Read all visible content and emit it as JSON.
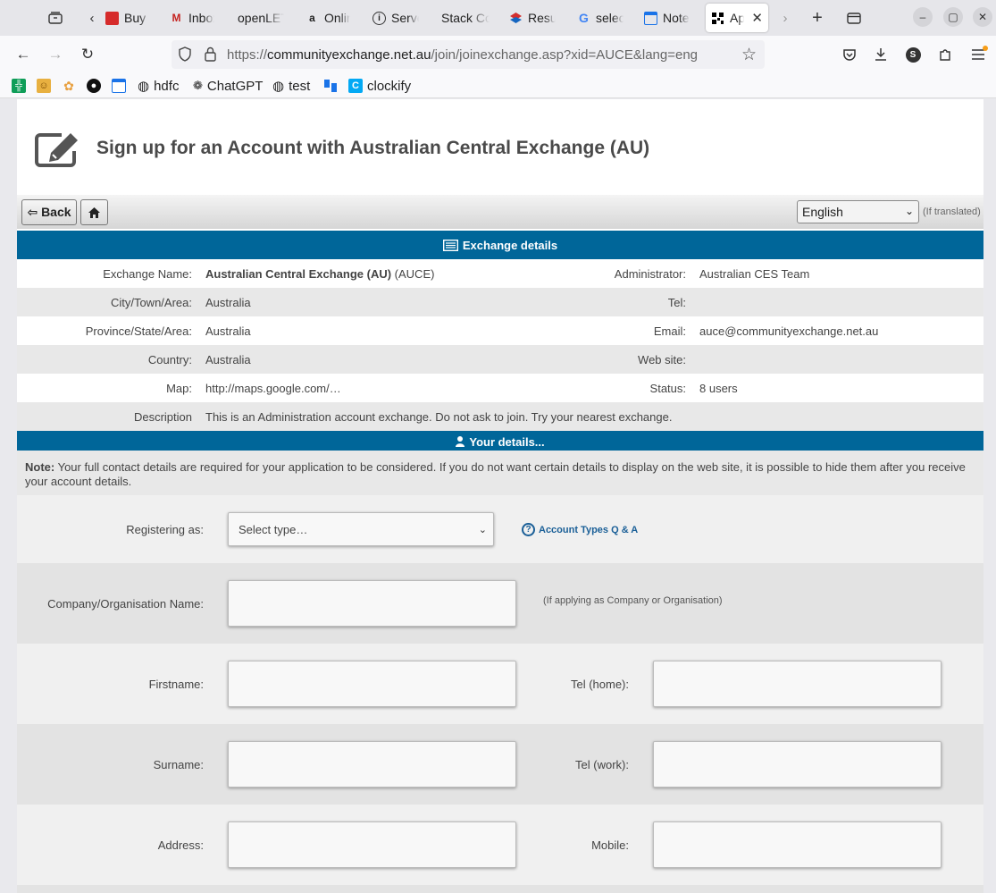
{
  "browser": {
    "tabs": [
      {
        "title": "Buy E",
        "favicon": "red-flag-icon",
        "color": "#d62b2b"
      },
      {
        "title": "Inbox",
        "favicon": "gmail-icon",
        "color": "#c5221f"
      },
      {
        "title": "openLET",
        "favicon": "",
        "color": ""
      },
      {
        "title": "Onlin",
        "favicon": "amazon-icon",
        "color": "#222222"
      },
      {
        "title": "Serve",
        "favicon": "info-icon",
        "color": "#333333"
      },
      {
        "title": "Stack Co",
        "favicon": "",
        "color": ""
      },
      {
        "title": "Resu",
        "favicon": "layers-icon",
        "color": "#d32f2f"
      },
      {
        "title": "selec",
        "favicon": "google-icon",
        "color": "#4285f4"
      },
      {
        "title": "Note",
        "favicon": "calendar-icon",
        "color": "#1a73e8"
      },
      {
        "title": "Ap",
        "favicon": "qr-icon",
        "color": "#000000",
        "active": true
      }
    ],
    "url_prefix": "https://",
    "url_domain": "communityexchange.net.au",
    "url_path": "/join/joinexchange.asp?xid=AUCE&lang=eng",
    "profile_letter": "S",
    "bookmarks": [
      {
        "label": "",
        "icon": "sheets-icon"
      },
      {
        "label": "",
        "icon": "face-icon"
      },
      {
        "label": "",
        "icon": "lotus-icon"
      },
      {
        "label": "",
        "icon": "github-icon"
      },
      {
        "label": "",
        "icon": "calendar-icon"
      },
      {
        "label": "hdfc",
        "icon": "globe-icon"
      },
      {
        "label": "ChatGPT",
        "icon": "chatgpt-icon"
      },
      {
        "label": "test",
        "icon": "globe-icon"
      },
      {
        "label": "",
        "icon": "trello-icon"
      },
      {
        "label": "clockify",
        "icon": "clockify-icon"
      }
    ]
  },
  "page": {
    "title": "Sign up for an Account with Australian Central Exchange (AU)",
    "back_label": "⇦ Back",
    "language": "English",
    "language_note": "(If translated)",
    "exchange_section": "Exchange details",
    "details": {
      "exchange_name_label": "Exchange Name:",
      "exchange_name_bold": "Australian Central Exchange (AU)",
      "exchange_name_code": "(AUCE)",
      "administrator_label": "Administrator:",
      "administrator": "Australian CES Team",
      "city_label": "City/Town/Area:",
      "city": "Australia",
      "tel_label": "Tel:",
      "province_label": "Province/State/Area:",
      "province": "Australia",
      "email_label": "Email:",
      "email": "auce@communityexchange.net.au",
      "country_label": "Country:",
      "country": "Australia",
      "website_label": "Web site:",
      "map_label": "Map:",
      "map": "http://maps.google.com/…",
      "status_label": "Status:",
      "status": "8 users",
      "description_label": "Description",
      "description": "This is an Administration account exchange. Do not ask to join. Try your nearest exchange."
    },
    "your_details_section": "Your details...",
    "note_bold": "Note:",
    "note_text": " Your full contact details are required for your application to be considered. If you do not want certain details to display on the web site, it is possible to hide them after you receive your account details.",
    "form": {
      "registering_label": "Registering as:",
      "registering_value": "Select type…",
      "account_types_link": "Account Types Q & A",
      "company_label": "Company/Organisation Name:",
      "company_hint": "(If applying as Company or Organisation)",
      "firstname_label": "Firstname:",
      "tel_home_label": "Tel (home):",
      "surname_label": "Surname:",
      "tel_work_label": "Tel (work):",
      "address_label": "Address:",
      "mobile_label": "Mobile:"
    },
    "colors": {
      "section_bar": "#006699",
      "link": "#1a5f97"
    }
  }
}
